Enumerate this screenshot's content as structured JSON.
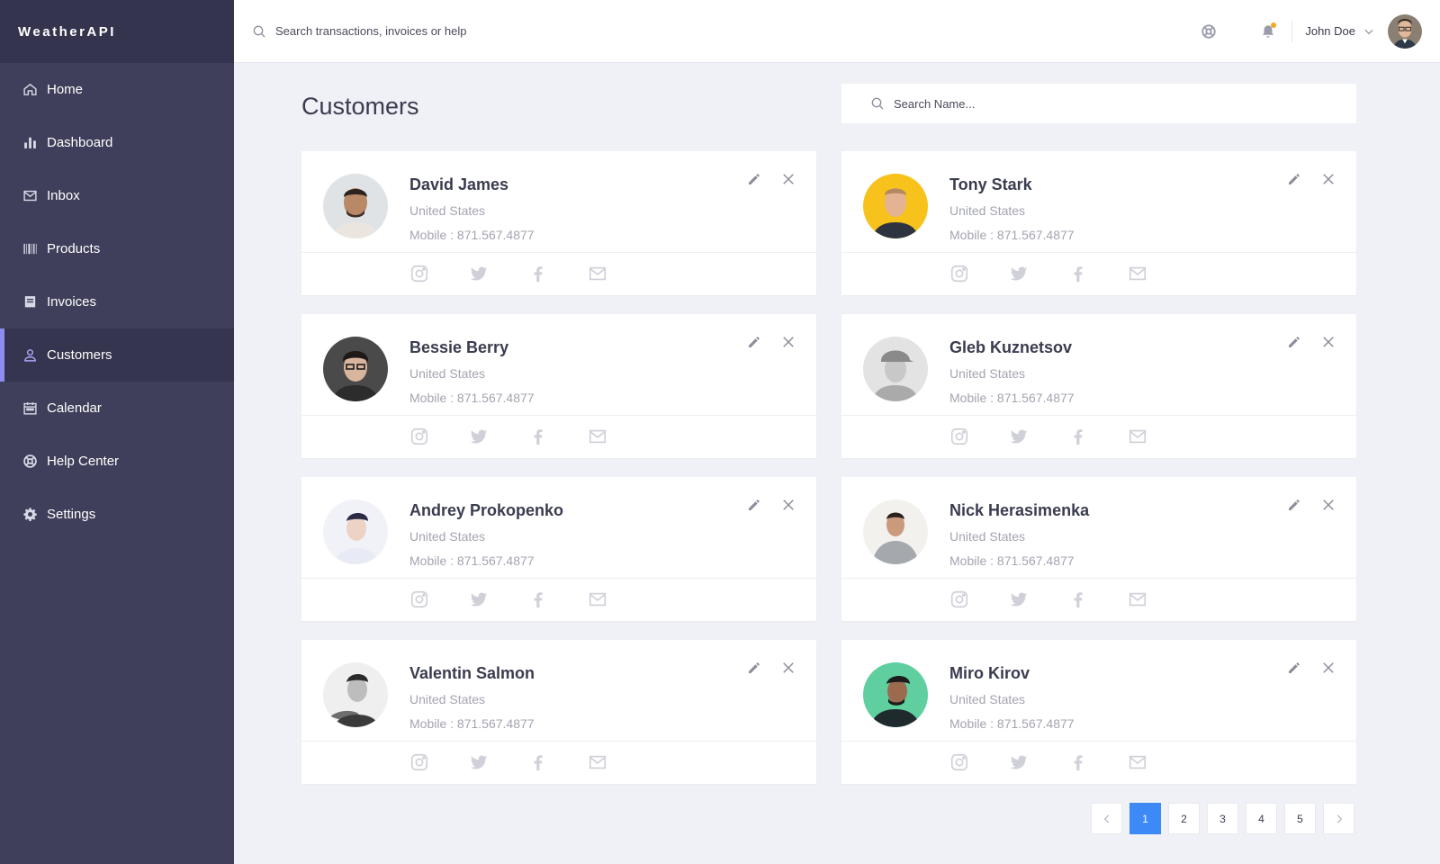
{
  "brand": "WeatherAPI",
  "nav": [
    {
      "label": "Home",
      "icon": "home-icon"
    },
    {
      "label": "Dashboard",
      "icon": "bar-chart-icon"
    },
    {
      "label": "Inbox",
      "icon": "inbox-icon"
    },
    {
      "label": "Products",
      "icon": "barcode-icon"
    },
    {
      "label": "Invoices",
      "icon": "invoice-icon"
    },
    {
      "label": "Customers",
      "icon": "user-icon",
      "active": true
    },
    {
      "label": "Calendar",
      "icon": "calendar-icon"
    },
    {
      "label": "Help Center",
      "icon": "lifebuoy-icon"
    },
    {
      "label": "Settings",
      "icon": "gear-icon"
    }
  ],
  "header": {
    "search_placeholder": "Search transactions, invoices or help",
    "user_name": "John Doe"
  },
  "page": {
    "title": "Customers",
    "search_placeholder": "Search Name..."
  },
  "customers": [
    {
      "name": "David James",
      "country": "United States",
      "mobile": "Mobile : 871.567.4877"
    },
    {
      "name": "Tony Stark",
      "country": "United States",
      "mobile": "Mobile : 871.567.4877"
    },
    {
      "name": "Bessie Berry",
      "country": "United States",
      "mobile": "Mobile : 871.567.4877"
    },
    {
      "name": "Gleb Kuznetsov",
      "country": "United States",
      "mobile": "Mobile : 871.567.4877"
    },
    {
      "name": "Andrey Prokopenko",
      "country": "United States",
      "mobile": "Mobile : 871.567.4877"
    },
    {
      "name": "Nick Herasimenka",
      "country": "United States",
      "mobile": "Mobile : 871.567.4877"
    },
    {
      "name": "Valentin Salmon",
      "country": "United States",
      "mobile": "Mobile : 871.567.4877"
    },
    {
      "name": "Miro Kirov",
      "country": "United States",
      "mobile": "Mobile : 871.567.4877"
    }
  ],
  "pagination": {
    "pages": [
      "1",
      "2",
      "3",
      "4",
      "5"
    ],
    "current": "1"
  },
  "colors": {
    "sidebar": "#3f3f5b",
    "sidebar_brand": "#34344e",
    "accent_active": "#8f8cf0",
    "pager_active": "#3d8af7",
    "notification_dot": "#f5a623"
  }
}
